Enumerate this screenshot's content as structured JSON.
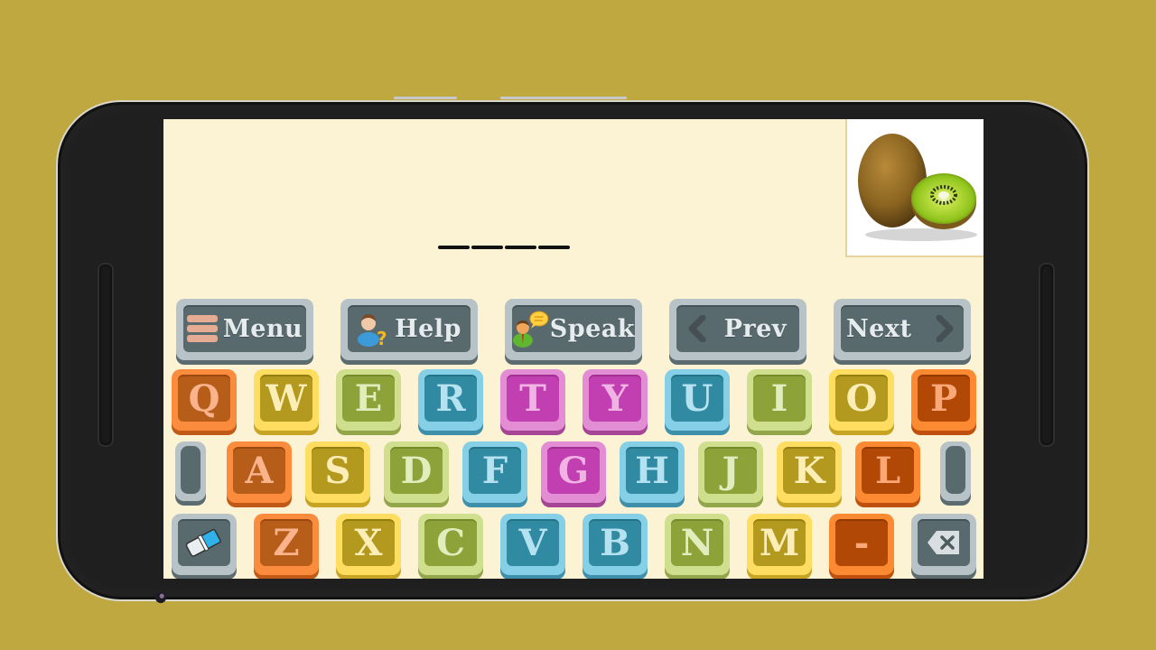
{
  "app": {
    "answer_slots": 4,
    "picture": {
      "subject": "kiwi",
      "icon": "kiwi-fruit-image"
    }
  },
  "controls": [
    {
      "id": "menu",
      "label": "Menu",
      "icon": "menu-icon"
    },
    {
      "id": "help",
      "label": "Help",
      "icon": "help-user-icon"
    },
    {
      "id": "speak",
      "label": "Speak",
      "icon": "speak-user-icon"
    },
    {
      "id": "prev",
      "label": "Prev",
      "icon": "chevron-left-icon"
    },
    {
      "id": "next",
      "label": "Next",
      "icon": "chevron-right-icon"
    }
  ],
  "keyboard": {
    "row1": [
      "Q",
      "W",
      "E",
      "R",
      "T",
      "Y",
      "U",
      "I",
      "O",
      "P"
    ],
    "row2": [
      "A",
      "S",
      "D",
      "F",
      "G",
      "H",
      "J",
      "K",
      "L"
    ],
    "row3": [
      "Z",
      "X",
      "C",
      "V",
      "B",
      "N",
      "M",
      "-"
    ],
    "clear_icon": "eraser-icon",
    "backspace_icon": "backspace-icon"
  },
  "colors": {
    "background": "#c0a841",
    "screen": "#fbf3d4",
    "orange": "#fb8c3e",
    "yellow": "#fedd60",
    "green": "#cfdf8e",
    "blue": "#86d0e7",
    "pink": "#e38dd4",
    "gray": "#b7c3c7"
  }
}
